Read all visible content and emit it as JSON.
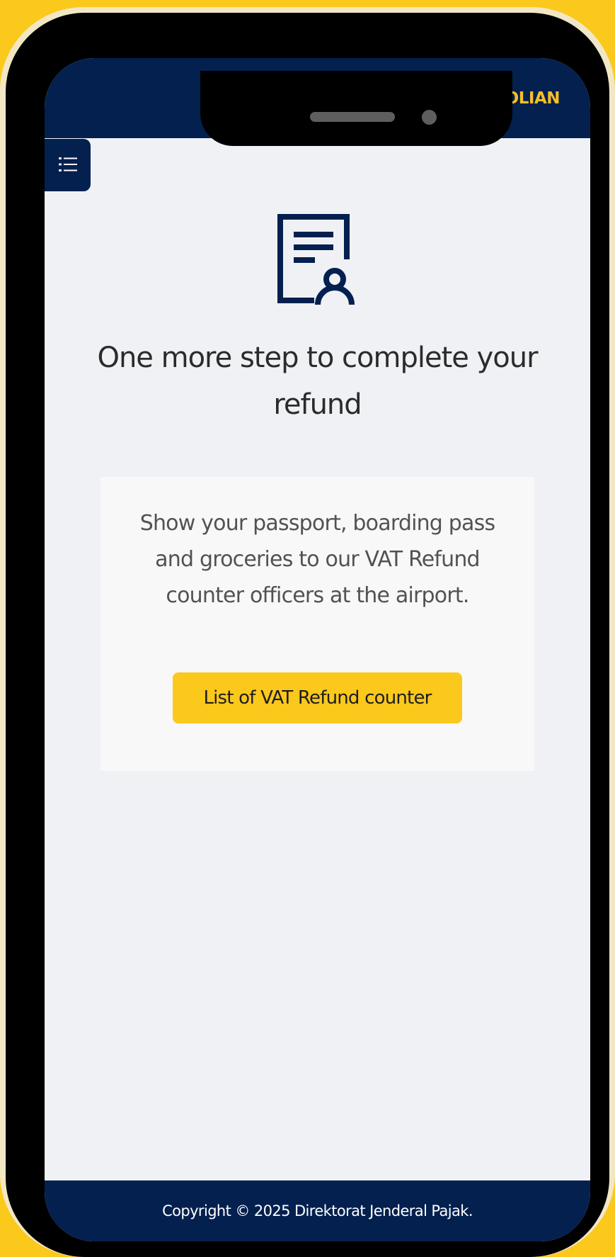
{
  "header": {
    "user_name": "FU BOLIAN"
  },
  "menu": {
    "icon": "list-icon"
  },
  "main": {
    "icon": "document-user-icon",
    "headline": "One more step to complete your refund",
    "info_text": "Show your passport, boarding pass and groceries to our VAT Refund counter officers at the airport.",
    "button_label": "List of VAT Refund counter"
  },
  "footer": {
    "copyright": "Copyright © 2025 Direktorat Jenderal Pajak."
  },
  "colors": {
    "brand_navy": "#03204F",
    "accent_yellow": "#FBC81C",
    "user_name_gold": "#F6BF26"
  }
}
